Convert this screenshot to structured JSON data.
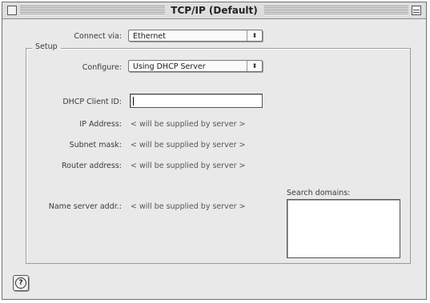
{
  "window": {
    "title": "TCP/IP (Default)"
  },
  "connect_via": {
    "label": "Connect via:",
    "value": "Ethernet"
  },
  "setup": {
    "legend": "Setup",
    "configure": {
      "label": "Configure:",
      "value": "Using DHCP Server"
    },
    "dhcp_client_id": {
      "label": "DHCP Client ID:",
      "value": ""
    },
    "ip_address": {
      "label": "IP Address:",
      "value": "< will be supplied by server >"
    },
    "subnet_mask": {
      "label": "Subnet mask:",
      "value": "< will be supplied by server >"
    },
    "router_address": {
      "label": "Router address:",
      "value": "< will be supplied by server >"
    },
    "name_server": {
      "label": "Name server addr.:",
      "value": "< will be supplied by server >"
    },
    "search_domains": {
      "label": "Search domains:",
      "value": ""
    }
  },
  "help": {
    "glyph": "?"
  },
  "icons": {
    "popup_arrows": "⬍"
  }
}
